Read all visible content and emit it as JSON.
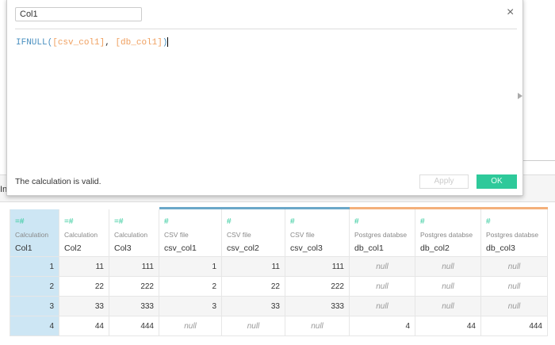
{
  "background": {
    "left_text": "In"
  },
  "dialog": {
    "name": "Col1",
    "formula": {
      "fn": "IFNULL(",
      "arg1": "[csv_col1]",
      "sep": ", ",
      "arg2": "[db_col1]",
      "close": ")"
    },
    "status": "The calculation is valid.",
    "apply_label": "Apply",
    "ok_label": "OK",
    "close_icon": "×"
  },
  "colors": {
    "accent": "#2ec99a",
    "csv": "#6aa7c8",
    "db": "#f4b07a"
  },
  "table": {
    "columns": [
      {
        "icon": "=#",
        "source": "Calculation",
        "name": "Col1",
        "group": "calc"
      },
      {
        "icon": "=#",
        "source": "Calculation",
        "name": "Col2",
        "group": "calc"
      },
      {
        "icon": "=#",
        "source": "Calculation",
        "name": "Col3",
        "group": "calc"
      },
      {
        "icon": "#",
        "source": "CSV file",
        "name": "csv_col1",
        "group": "csv"
      },
      {
        "icon": "#",
        "source": "CSV file",
        "name": "csv_col2",
        "group": "csv"
      },
      {
        "icon": "#",
        "source": "CSV file",
        "name": "csv_col3",
        "group": "csv"
      },
      {
        "icon": "#",
        "source": "Postgres databse",
        "name": "db_col1",
        "group": "db"
      },
      {
        "icon": "#",
        "source": "Postgres databse",
        "name": "db_col2",
        "group": "db"
      },
      {
        "icon": "#",
        "source": "Postgres databse",
        "name": "db_col3",
        "group": "db"
      }
    ],
    "rows": [
      [
        "1",
        "11",
        "111",
        "1",
        "11",
        "111",
        "null",
        "null",
        "null"
      ],
      [
        "2",
        "22",
        "222",
        "2",
        "22",
        "222",
        "null",
        "null",
        "null"
      ],
      [
        "3",
        "33",
        "333",
        "3",
        "33",
        "333",
        "null",
        "null",
        "null"
      ],
      [
        "4",
        "44",
        "444",
        "null",
        "null",
        "null",
        "4",
        "44",
        "444"
      ]
    ]
  }
}
